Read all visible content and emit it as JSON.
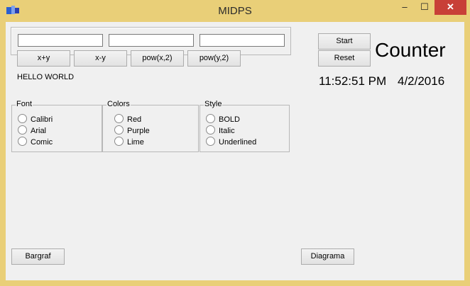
{
  "window": {
    "title": "MIDPS",
    "min": "–",
    "max": "☐",
    "close": "✕"
  },
  "inputs": {
    "a": "",
    "b": "",
    "c": ""
  },
  "buttons": {
    "add": "x+y",
    "sub": "x-y",
    "powx": "pow(x,2)",
    "powy": "pow(y,2)",
    "start": "Start",
    "reset": "Reset",
    "bargraf": "Bargraf",
    "diagrama": "Diagrama"
  },
  "output_label": "HELLO WORLD",
  "counter_label": "Counter",
  "clock": {
    "time": "11:52:51 PM",
    "date": "4/2/2016"
  },
  "groups": {
    "font": {
      "caption": "Font",
      "options": [
        "Calibri",
        "Arial",
        "Comic"
      ]
    },
    "colors": {
      "caption": "Colors",
      "options": [
        "Red",
        "Purple",
        "Lime"
      ]
    },
    "style": {
      "caption": "Style",
      "options": [
        "BOLD",
        "Italic",
        "Underlined"
      ]
    }
  }
}
